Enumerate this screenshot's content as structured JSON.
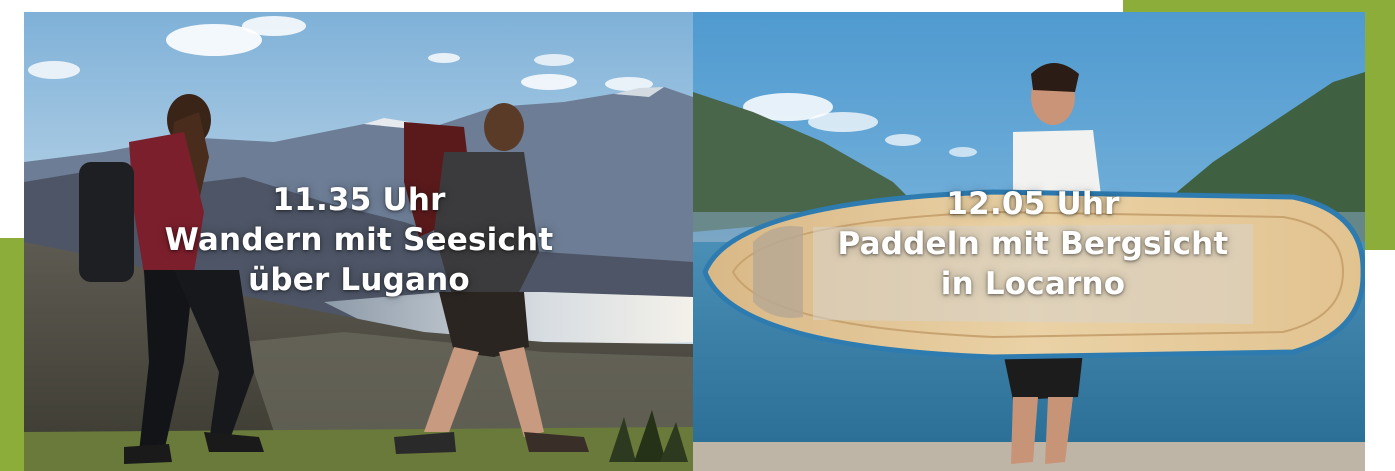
{
  "colors": {
    "accent_green": "#8dad3b",
    "sky_left": "#b9d3e6",
    "sky_right": "#5ea4d4",
    "lake_right": "#3f86b0"
  },
  "panels": [
    {
      "time": "11.35 Uhr",
      "line1": "Wandern mit Seesicht",
      "line2": "über Lugano"
    },
    {
      "time": "12.05 Uhr",
      "line1": "Paddeln mit Bergsicht",
      "line2": "in Locarno"
    }
  ]
}
